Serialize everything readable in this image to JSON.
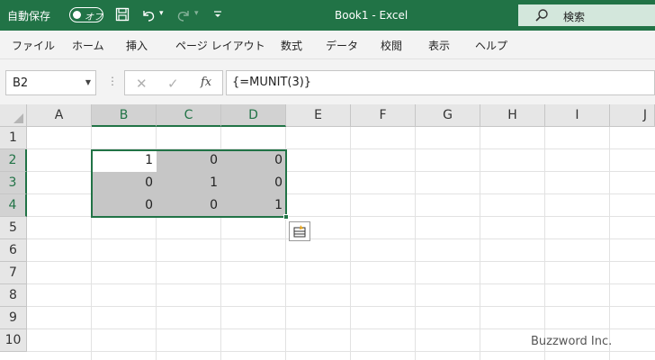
{
  "titlebar": {
    "autosave_label": "自動保存",
    "autosave_state": "オフ",
    "doc_title": "Book1  -  Excel",
    "search_placeholder": "検索",
    "brand_color": "#217346"
  },
  "ribbon": {
    "tabs": [
      "ファイル",
      "ホーム",
      "挿入",
      "ページ レイアウト",
      "数式",
      "データ",
      "校閲",
      "表示",
      "ヘルプ"
    ]
  },
  "formula_bar": {
    "name_box": "B2",
    "formula": "{=MUNIT(3)}",
    "cancel_icon": "✕",
    "enter_icon": "✓",
    "fx_label": "fx"
  },
  "sheet": {
    "columns": [
      "A",
      "B",
      "C",
      "D",
      "E",
      "F",
      "G",
      "H",
      "I",
      "J"
    ],
    "rows": [
      "1",
      "2",
      "3",
      "4",
      "5",
      "6",
      "7",
      "8",
      "9",
      "10"
    ],
    "cells": {
      "B2": "1",
      "C2": "0",
      "D2": "0",
      "B3": "0",
      "C3": "1",
      "D3": "0",
      "B4": "0",
      "C4": "0",
      "D4": "1"
    }
  },
  "watermark": "Buzzword Inc."
}
